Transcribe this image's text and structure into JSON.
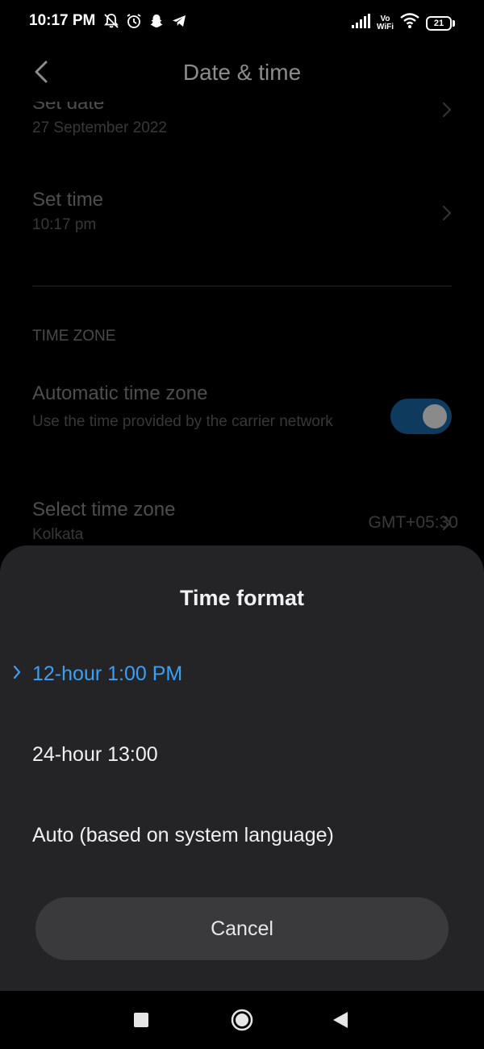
{
  "status_bar": {
    "time": "10:17 PM",
    "volte_line1": "Vo",
    "volte_line2": "WiFi",
    "battery_level": "21"
  },
  "header": {
    "title": "Date & time"
  },
  "settings": {
    "set_date": {
      "title": "Set date",
      "value": "27 September 2022"
    },
    "set_time": {
      "title": "Set time",
      "value": "10:17 pm"
    },
    "time_zone_section": "TIME ZONE",
    "automatic_time_zone": {
      "title": "Automatic time zone",
      "subtitle": "Use the time provided by the carrier network",
      "enabled": true
    },
    "select_time_zone": {
      "title": "Select time zone",
      "value": "Kolkata",
      "offset": "GMT+05:30"
    }
  },
  "dialog": {
    "title": "Time format",
    "options": [
      {
        "label": "12-hour 1:00 PM",
        "selected": true
      },
      {
        "label": "24-hour 13:00",
        "selected": false
      },
      {
        "label": "Auto (based on system language)",
        "selected": false
      }
    ],
    "cancel_label": "Cancel"
  },
  "colors": {
    "accent": "#3aa0f5",
    "sheet_background": "#242426",
    "button_background": "#3a3a3c"
  }
}
